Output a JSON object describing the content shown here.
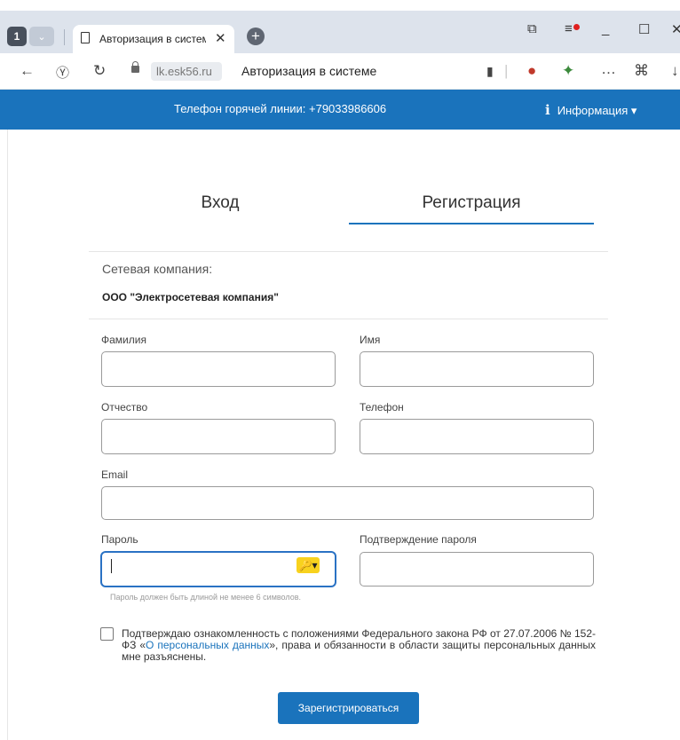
{
  "browser": {
    "tab_count": "1",
    "tab_title": "Авторизация в систем",
    "address_domain": "lk.esk56.ru",
    "address_title": "Авторизация в системе",
    "tab_count_icon": "tabs-counter-icon",
    "window_controls": [
      "minimize",
      "maximize",
      "close"
    ]
  },
  "header": {
    "hotline": "Телефон горячей линии: +79033986606",
    "info_label": "Информация",
    "color": "#1a73bc"
  },
  "auth_tabs": {
    "login": "Вход",
    "register": "Регистрация",
    "active": "register"
  },
  "company": {
    "label": "Сетевая компания:",
    "value": "ООО \"Электросетевая компания\""
  },
  "form": {
    "last_name_label": "Фамилия",
    "first_name_label": "Имя",
    "patronymic_label": "Отчество",
    "phone_label": "Телефон",
    "email_label": "Email",
    "password_label": "Пароль",
    "password_confirm_label": "Подтверждение пароля",
    "password_hint": "Пароль должен быть длиной не менее 6 символов.",
    "consent_before": "Подтверждаю ознакомленность с положениями Федерального закона РФ от 27.07.2006 № 152-ФЗ «",
    "consent_link": "О персональных данных",
    "consent_after": "», права и обязанности в области защиты персональных данных мне разъяснены.",
    "consent_checked": false,
    "submit_label": "Зарегистрироваться"
  }
}
